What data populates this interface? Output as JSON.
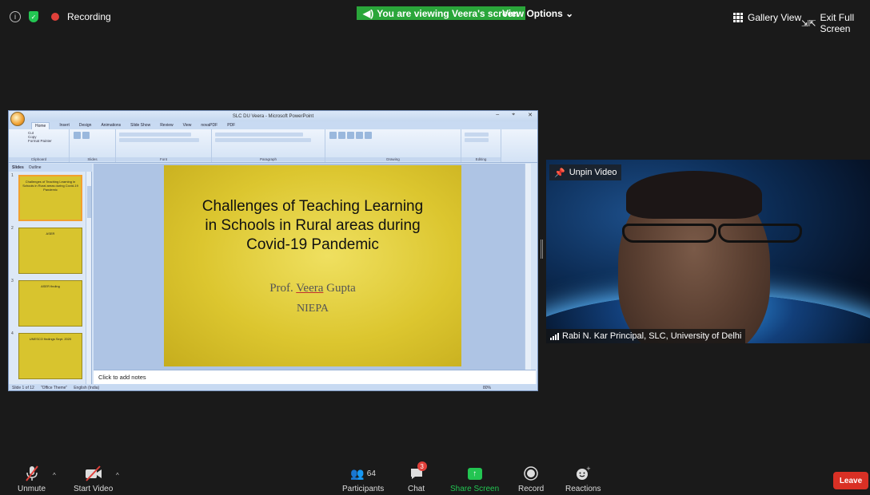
{
  "topbar": {
    "info_icon": "info-icon",
    "shield_icon": "shield-check-icon",
    "recording": "Recording",
    "viewing_banner": "You are viewing Veera's screen",
    "view_options": "View Options",
    "gallery_view": "Gallery View",
    "exit_full_screen": "Exit Full Screen"
  },
  "ppt": {
    "window_title": "SLC DU Veera - Microsoft PowerPoint",
    "tabs": [
      "Home",
      "Insert",
      "Design",
      "Animations",
      "Slide Show",
      "Review",
      "View",
      "novaPDF",
      "PDF"
    ],
    "groups": [
      "Clipboard",
      "Slides",
      "Font",
      "Paragraph",
      "Drawing",
      "Editing"
    ],
    "clipboard_items": [
      "Cut",
      "Copy",
      "Format Painter"
    ],
    "pane_tabs": [
      "Slides",
      "Outline"
    ],
    "thumbnails": [
      {
        "num": "1",
        "text": "Challenges of Teaching Learning in Schools in Rural areas during Covid-19 Pandemic"
      },
      {
        "num": "2",
        "text": "ASER"
      },
      {
        "num": "3",
        "text": "ASER finding"
      },
      {
        "num": "4",
        "text": "UNESCO findings Sept. 2020"
      }
    ],
    "slide": {
      "title_line1": "Challenges of Teaching Learning",
      "title_line2": "in Schools in Rural areas during",
      "title_line3": "Covid-19 Pandemic",
      "author_prefix": "Prof. ",
      "author_first": "Veera",
      "author_last": " Gupta",
      "org": "NIEPA"
    },
    "notes_placeholder": "Click to add notes",
    "status": {
      "slide_of": "Slide 1 of 12",
      "theme": "\"Office Theme\"",
      "language": "English (India)",
      "zoom": "80%"
    }
  },
  "video": {
    "unpin": "Unpin Video",
    "name": "Rabi N. Kar Principal, SLC, University of Delhi"
  },
  "toolbar": {
    "unmute": "Unmute",
    "start_video": "Start Video",
    "participants": "Participants",
    "participants_count": "64",
    "chat": "Chat",
    "chat_badge": "3",
    "share_screen": "Share Screen",
    "record": "Record",
    "reactions": "Reactions",
    "leave": "Leave"
  },
  "colors": {
    "accent_green": "#23c552",
    "leave_red": "#d93025",
    "slide_bg": "#dcc62f"
  }
}
